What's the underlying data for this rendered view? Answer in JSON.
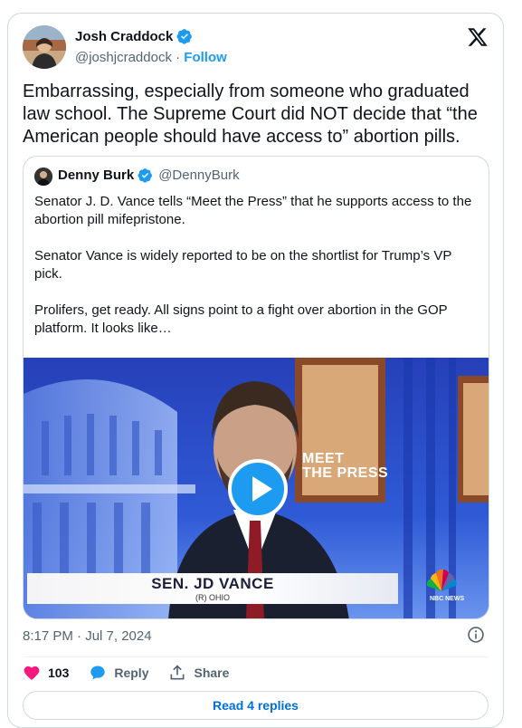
{
  "author": {
    "name": "Josh Craddock",
    "handle": "@joshjcraddock",
    "separator": "·",
    "follow_label": "Follow",
    "verified": true
  },
  "platform_logo": "x-logo-icon",
  "tweet": {
    "text": "Embarrassing, especially from someone who graduated law school. The Supreme Court did NOT decide that “the American people should have access to” abortion pills."
  },
  "quoted": {
    "name": "Denny Burk",
    "handle": "@DennyBurk",
    "verified": true,
    "paragraphs": [
      "Senator J. D. Vance tells “Meet the Press” that he supports access to the abortion pill mifepristone.",
      "Senator Vance is widely reported to be on the shortlist for Trump’s VP pick.",
      "Prolifers, get ready. All signs point to a fight over abortion in the GOP platform. It looks like…"
    ],
    "video": {
      "lower_third_name": "SEN. JD VANCE",
      "lower_third_sub": "(R) OHIO",
      "show_logo_line1": "MEET",
      "show_logo_line2": "THE PRESS",
      "network": "NBC NEWS"
    }
  },
  "meta": {
    "timestamp": "8:17 PM · Jul 7, 2024"
  },
  "actions": {
    "like_count": "103",
    "reply_label": "Reply",
    "share_label": "Share"
  },
  "replies_button": "Read 4 replies",
  "colors": {
    "accent": "#1d9bf0",
    "like": "#f91880",
    "link": "#006fd6",
    "secondary_text": "#536471",
    "border": "#cfd9de"
  }
}
